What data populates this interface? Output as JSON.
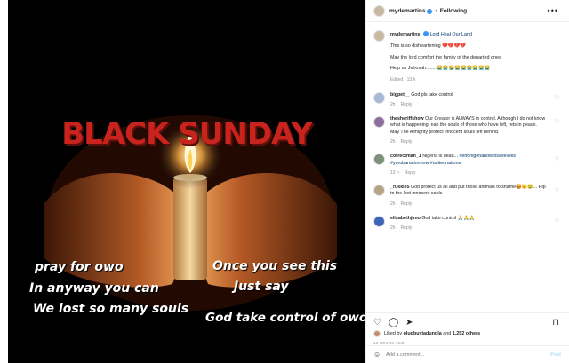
{
  "post": {
    "author": "mydemartins",
    "follow_state": "Following",
    "separator": "•",
    "location": "Lord Heal Our Land",
    "caption_lines": [
      "This is so disheartening 💔💔💔💔",
      "May the lord comfort the family of the departed ones",
      "Help us Jehovah........😭😭😭😭😭😭😭😭😭"
    ],
    "caption_meta": "Edited · 13 h"
  },
  "media": {
    "headline": "BLACK SUNDAY",
    "left_lines": [
      "pray for owo",
      "In anyway you can",
      "We lost so many souls"
    ],
    "right_lines": [
      "Once you see this",
      "Just say"
    ],
    "bottom_line": "God take control of owo"
  },
  "comments": [
    {
      "user": "bigpet__",
      "text": "God pls take control",
      "time": "2h",
      "reply": "Reply"
    },
    {
      "user": "thesheriffshow",
      "text": "Our Creator is ALWAYS in control. Although I do not know what is happening, nah the souls of those who have left, rets in peace. May The Almighty protect innocent souls left behind.",
      "time": "2h",
      "reply": "Reply"
    },
    {
      "user": "correctman_1",
      "text": "Nigeria is dead...",
      "tags": "#endnigerianowtosavelives #yorubanationnow #unitednations",
      "time": "13 h",
      "reply": "Reply"
    },
    {
      "user": "_rukkie5",
      "text": "God protect us all and put those animals to shame😡😠😢... Rip to the lost innocent souls",
      "time": "2h",
      "reply": "Reply"
    },
    {
      "user": "elisabethjimo",
      "text": "God take control 🙏🙏🙏",
      "time": "2h",
      "reply": "Reply"
    }
  ],
  "footer": {
    "likes_prefix": "Liked by",
    "likes_user": "olugbuyiadunola",
    "likes_and": "and",
    "likes_count": "1,252 others",
    "timestamp": "13 HOURS AGO",
    "add_comment_placeholder": "Add a comment...",
    "post_label": "Post"
  },
  "icons": {
    "heart": "♡",
    "comment": "◯",
    "share": "➤",
    "save": "⊓",
    "smile": "☺",
    "more": "•••"
  },
  "colors": {
    "headline": "#c9231d",
    "link": "#00376b",
    "verified": "#3897f0",
    "post_disabled": "#b2dffc"
  }
}
